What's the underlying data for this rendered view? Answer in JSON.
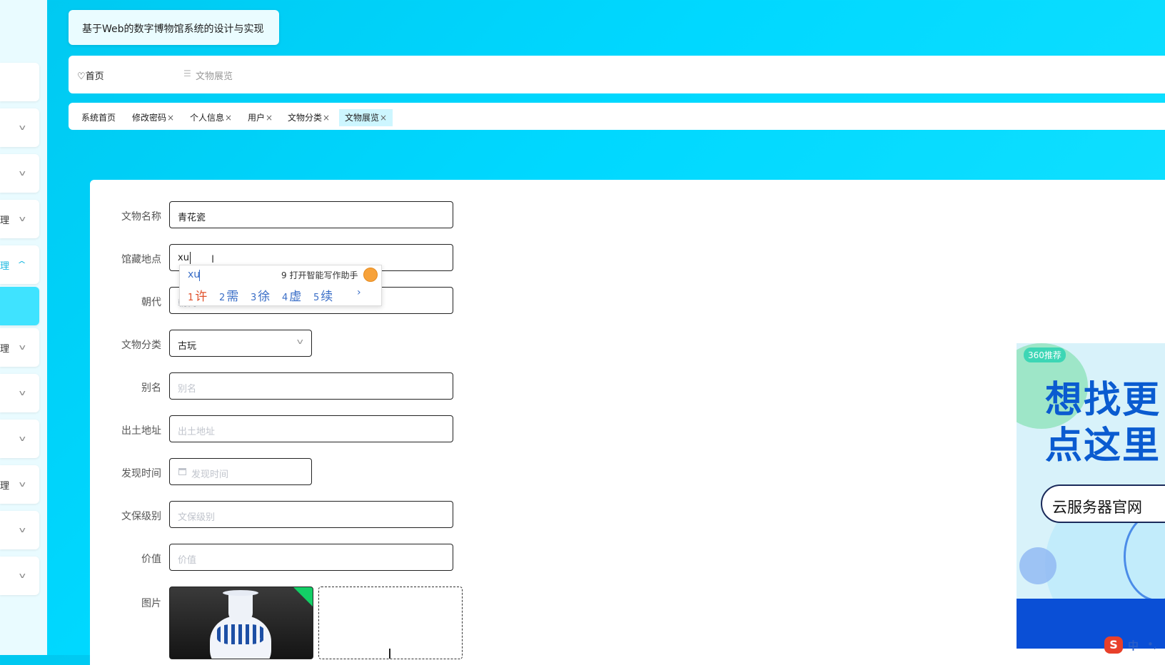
{
  "app": {
    "title": "基于Web的数字博物馆系统的设计与实现"
  },
  "sidebar": {
    "first_char": "",
    "items": [
      {
        "label": "",
        "chevron": ""
      },
      {
        "label": "",
        "chevron": "v"
      },
      {
        "label": "",
        "chevron": "v"
      },
      {
        "label": "理",
        "chevron": "v"
      },
      {
        "label": "理",
        "chevron": "^"
      },
      {
        "label": "",
        "chevron": ""
      },
      {
        "label": "理",
        "chevron": "v"
      },
      {
        "label": "",
        "chevron": "v"
      },
      {
        "label": "",
        "chevron": "v"
      },
      {
        "label": "理",
        "chevron": "v"
      },
      {
        "label": "",
        "chevron": "v"
      },
      {
        "label": "",
        "chevron": "v"
      }
    ]
  },
  "breadcrumb": {
    "home": "♡首页",
    "separator": "☰",
    "current": "文物展览"
  },
  "tabs": [
    {
      "label": "系统首页",
      "close": ""
    },
    {
      "label": "修改密码",
      "close": "×"
    },
    {
      "label": "个人信息",
      "close": "×"
    },
    {
      "label": "用户",
      "close": "×"
    },
    {
      "label": "文物分类",
      "close": "×"
    },
    {
      "label": "文物展览",
      "close": "×"
    }
  ],
  "form": {
    "name": {
      "label": "文物名称",
      "value": "青花瓷"
    },
    "location": {
      "label": "馆藏地点",
      "value": "xu"
    },
    "dynasty": {
      "label": "朝代",
      "placeholder": "朝代"
    },
    "category": {
      "label": "文物分类",
      "value": "古玩"
    },
    "alias": {
      "label": "别名",
      "placeholder": "别名"
    },
    "origin": {
      "label": "出土地址",
      "placeholder": "出土地址"
    },
    "found_time": {
      "label": "发现时间",
      "placeholder": "发现时间"
    },
    "level": {
      "label": "文保级别",
      "placeholder": "文保级别"
    },
    "value": {
      "label": "价值",
      "placeholder": "价值"
    },
    "image": {
      "label": "图片"
    }
  },
  "ime": {
    "pinyin": "xu",
    "assistant": "9 打开智能写作助手",
    "candidates": [
      {
        "n": "1",
        "c": "许"
      },
      {
        "n": "2",
        "c": "需"
      },
      {
        "n": "3",
        "c": "徐"
      },
      {
        "n": "4",
        "c": "虚"
      },
      {
        "n": "5",
        "c": "续"
      }
    ],
    "next": "›"
  },
  "ad": {
    "tag": "360推荐",
    "line1": "想找更",
    "line2": "点这里",
    "button": "云服务器官网"
  },
  "tray": {
    "logo": "S",
    "lang": "中",
    "punct": "•,"
  }
}
